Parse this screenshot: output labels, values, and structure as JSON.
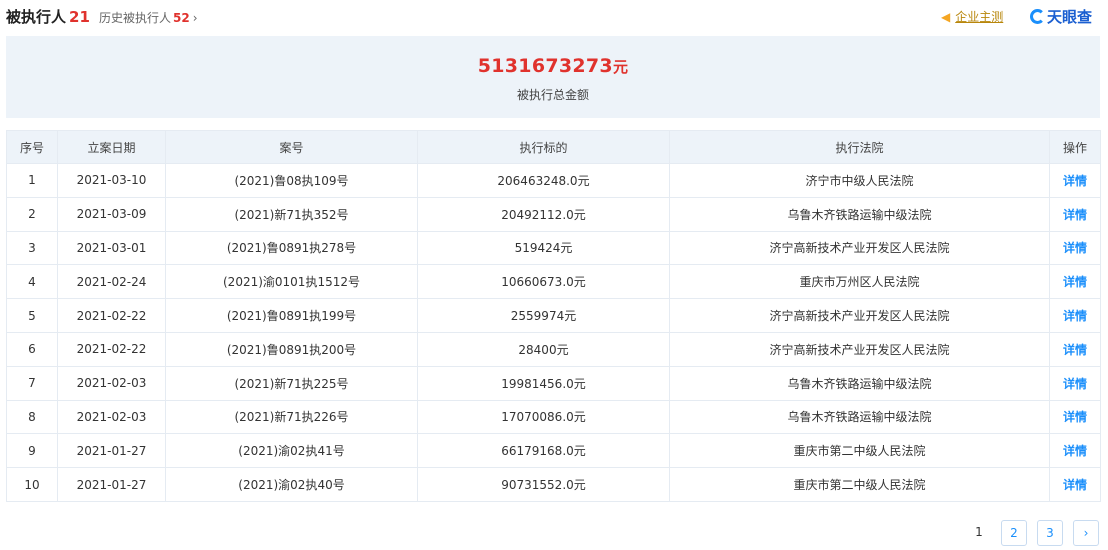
{
  "header": {
    "title": "被执行人",
    "title_count": "21",
    "history_label": "历史被执行人",
    "history_count": "52",
    "vip_label": "企业主测",
    "brand": "天眼查"
  },
  "summary": {
    "amount": "5131673273",
    "unit": "元",
    "label": "被执行总金额"
  },
  "table": {
    "columns": [
      "序号",
      "立案日期",
      "案号",
      "执行标的",
      "执行法院",
      "操作"
    ],
    "rows": [
      [
        "1",
        "2021-03-10",
        "(2021)鲁08执109号",
        "206463248.0元",
        "济宁市中级人民法院",
        "详情"
      ],
      [
        "2",
        "2021-03-09",
        "(2021)新71执352号",
        "20492112.0元",
        "乌鲁木齐铁路运输中级法院",
        "详情"
      ],
      [
        "3",
        "2021-03-01",
        "(2021)鲁0891执278号",
        "519424元",
        "济宁高新技术产业开发区人民法院",
        "详情"
      ],
      [
        "4",
        "2021-02-24",
        "(2021)渝0101执1512号",
        "10660673.0元",
        "重庆市万州区人民法院",
        "详情"
      ],
      [
        "5",
        "2021-02-22",
        "(2021)鲁0891执199号",
        "2559974元",
        "济宁高新技术产业开发区人民法院",
        "详情"
      ],
      [
        "6",
        "2021-02-22",
        "(2021)鲁0891执200号",
        "28400元",
        "济宁高新技术产业开发区人民法院",
        "详情"
      ],
      [
        "7",
        "2021-02-03",
        "(2021)新71执225号",
        "19981456.0元",
        "乌鲁木齐铁路运输中级法院",
        "详情"
      ],
      [
        "8",
        "2021-02-03",
        "(2021)新71执226号",
        "17070086.0元",
        "乌鲁木齐铁路运输中级法院",
        "详情"
      ],
      [
        "9",
        "2021-01-27",
        "(2021)渝02执41号",
        "66179168.0元",
        "重庆市第二中级人民法院",
        "详情"
      ],
      [
        "10",
        "2021-01-27",
        "(2021)渝02执40号",
        "90731552.0元",
        "重庆市第二中级人民法院",
        "详情"
      ]
    ]
  },
  "pagination": {
    "current": "1",
    "pages": [
      "2",
      "3"
    ],
    "next": "›"
  },
  "icons": {
    "vip": "speaker-icon",
    "brand": "tianyancha-logo-icon",
    "history_chevron": "chevron-right-icon"
  }
}
